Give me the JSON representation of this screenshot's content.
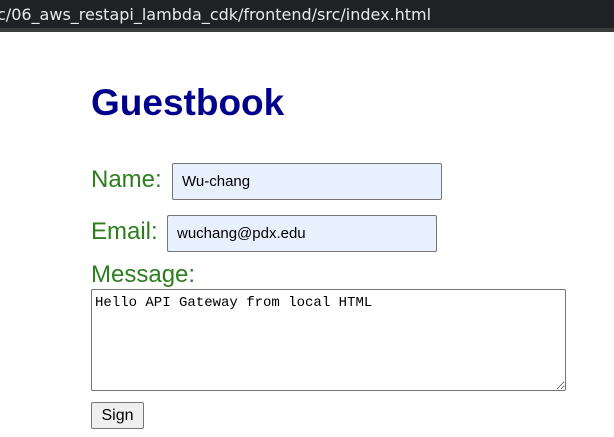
{
  "browser": {
    "url": "c/06_aws_restapi_lambda_cdk/frontend/src/index.html"
  },
  "page": {
    "title": "Guestbook"
  },
  "form": {
    "name_label": "Name:",
    "name_value": "Wu-chang",
    "email_label": "Email:",
    "email_value": "wuchang@pdx.edu",
    "message_label": "Message:",
    "message_value": "Hello API Gateway from local HTML",
    "submit_label": "Sign"
  },
  "colors": {
    "title": "#00008b",
    "label": "#2e7d1e",
    "autofill_background": "#e8f0fe"
  }
}
